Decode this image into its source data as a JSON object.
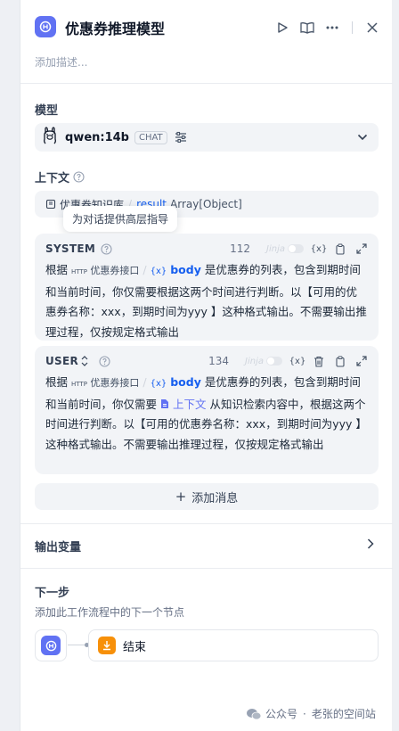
{
  "header": {
    "title": "优惠券推理模型",
    "description_placeholder": "添加描述..."
  },
  "model": {
    "label": "模型",
    "name": "qwen:14b",
    "mode_badge": "CHAT"
  },
  "context": {
    "label": "上下文",
    "variable_source": "优惠券知识库",
    "variable_name": "result",
    "variable_type": "Array[Object]",
    "tooltip": "为对话提供高层指导"
  },
  "messages": [
    {
      "role": "SYSTEM",
      "count": "112",
      "jinja_label": "Jinja",
      "text_before_vars": "根据",
      "http_source": "优惠券接口",
      "var_name": "body",
      "text_main": "是优惠券的列表，包含到期时间和当前时间，你仅需要根据这两个时间进行判断。以【可用的优惠券名称：xxx，到期时间为yyy 】这种格式输出。不需要输出推理过程，仅按规定格式输出"
    },
    {
      "role": "USER",
      "count": "134",
      "jinja_label": "Jinja",
      "text_before_vars": "根据",
      "http_source": "优惠券接口",
      "var_name": "body",
      "text_part1": "是优惠券的列表，包含到期时间和当前时间，你仅需要",
      "context_tag": "上下文",
      "text_part2": "从知识检索内容中，根据这两个时间进行判断。以【可用的优惠券名称：xxx，到期时间为yyy 】这种格式输出。不需要输出推理过程，仅按规定格式输出"
    }
  ],
  "add_message_label": "添加消息",
  "output_vars_label": "输出变量",
  "next_step": {
    "label": "下一步",
    "subtitle": "添加此工作流程中的下一个节点",
    "end_node_label": "结束"
  },
  "watermark": {
    "prefix": "公众号",
    "dot": "·",
    "name": "老张的空间站"
  },
  "colors": {
    "accent": "#6172f3",
    "link": "#155eef",
    "end_node": "#f79009"
  }
}
